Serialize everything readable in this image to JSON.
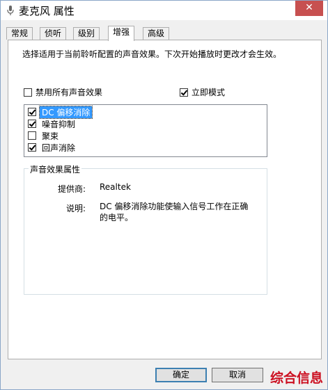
{
  "window": {
    "title": "麦克风 属性",
    "close_label": "✕"
  },
  "tabs": [
    {
      "label": "常规"
    },
    {
      "label": "侦听"
    },
    {
      "label": "级别"
    },
    {
      "label": "增强"
    },
    {
      "label": "高级"
    }
  ],
  "active_tab": "增强",
  "enhancements": {
    "description": "选择适用于当前聆听配置的声音效果。下次开始播放时更改才会生效。",
    "disable_all": {
      "label": "禁用所有声音效果",
      "checked": false
    },
    "immediate_mode": {
      "label": "立即模式",
      "checked": true
    },
    "items": [
      {
        "label": "DC 偏移消除",
        "checked": true,
        "selected": true
      },
      {
        "label": "噪音抑制",
        "checked": true,
        "selected": false
      },
      {
        "label": "聚束",
        "checked": false,
        "selected": false
      },
      {
        "label": "回声消除",
        "checked": true,
        "selected": false
      }
    ]
  },
  "properties": {
    "group_title": "声音效果属性",
    "provider_label": "提供商:",
    "provider_value": "Realtek",
    "description_label": "说明:",
    "description_value": "DC 偏移消除功能使输入信号工作在正确的电平。"
  },
  "buttons": {
    "ok": "确定",
    "cancel": "取消"
  },
  "watermark": "综合信息"
}
